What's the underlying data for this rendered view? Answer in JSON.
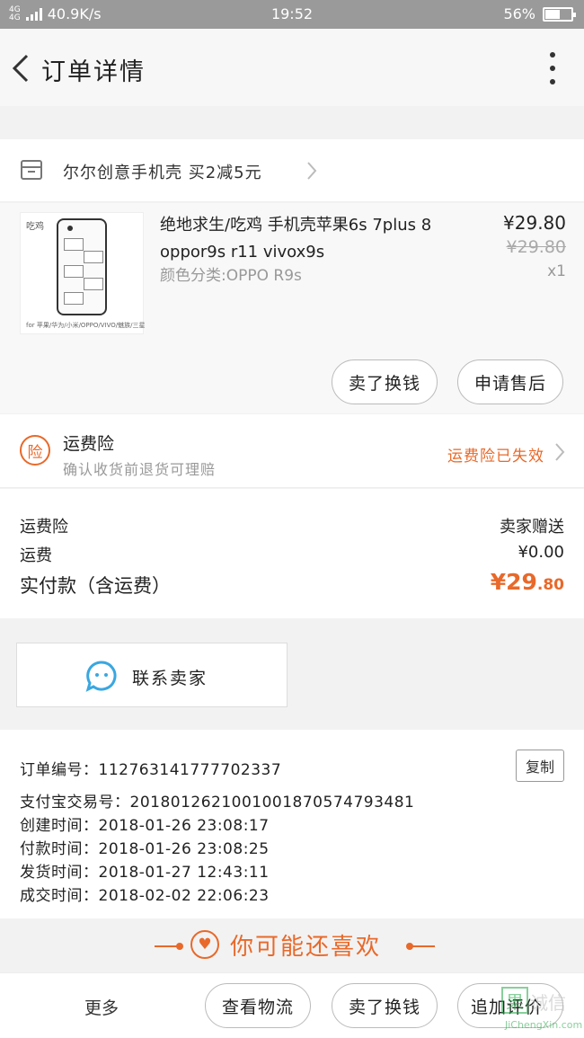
{
  "status": {
    "network": "4G",
    "network2": "4G",
    "speed": "40.9K/s",
    "time": "19:52",
    "battery": "56%"
  },
  "header": {
    "title": "订单详情"
  },
  "shop": {
    "name": "尔尔创意手机壳 买2减5元"
  },
  "item": {
    "name": "绝地求生/吃鸡 手机壳苹果6s 7plus 8 oppor9s r11 vivox9s",
    "sku": "颜色分类:OPPO R9s",
    "price": "¥29.80",
    "original_price": "¥29.80",
    "qty": "x1",
    "thumb_stamp": "吃鸡",
    "thumb_caption": "for 苹果/华为/小米/OPPO/VIVO/魅族/三星",
    "btn_sell": "卖了换钱",
    "btn_aftersale": "申请售后"
  },
  "insurance": {
    "badge": "险",
    "title": "运费险",
    "desc": "确认收货前退货可理赔",
    "status": "运费险已失效"
  },
  "fees": {
    "ins_label": "运费险",
    "ins_value": "卖家赠送",
    "ship_label": "运费",
    "ship_value": "¥0.00",
    "total_label": "实付款（含运费）",
    "total_main": "¥29",
    "total_dec": ".80"
  },
  "contact": {
    "label": "联系卖家"
  },
  "order": {
    "no": "订单编号：112763141777702337",
    "alipay": "支付宝交易号：2018012621001001870574793481",
    "created": "创建时间：2018-01-26 23:08:17",
    "paid": "付款时间：2018-01-26 23:08:25",
    "shipped": "发货时间：2018-01-27 12:43:11",
    "done": "成交时间：2018-02-02 22:06:23",
    "copy": "复制"
  },
  "recommend": {
    "title": "你可能还喜欢"
  },
  "bottom": {
    "more": "更多",
    "b1": "查看物流",
    "b2": "卖了换钱",
    "b3": "追加评价"
  },
  "watermark": {
    "box": "果",
    "text": "诚信",
    "url": "JiChengXin.com"
  },
  "colors": {
    "accent": "#e8692a",
    "statusbar": "#9a9a9a"
  }
}
